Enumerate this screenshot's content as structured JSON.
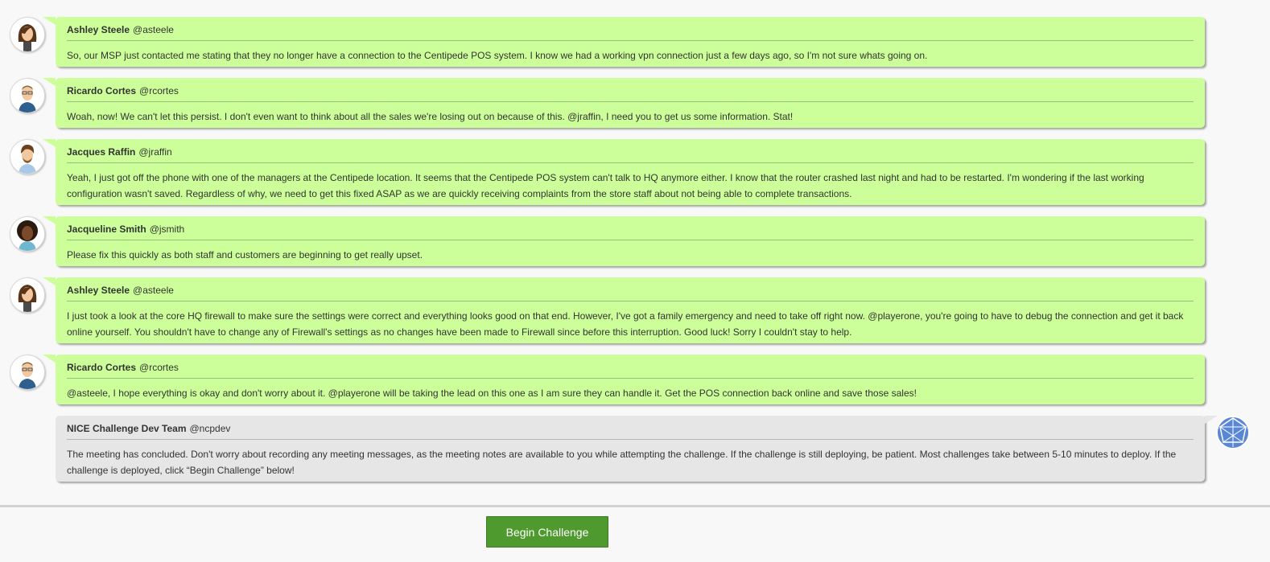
{
  "messages": [
    {
      "name": "Ashley Steele",
      "handle": "@asteele",
      "text": "So, our MSP just contacted me stating that they no longer have a connection to the Centipede POS system. I know we had a working vpn connection just a few days ago, so I'm not sure whats going on."
    },
    {
      "name": "Ricardo Cortes",
      "handle": "@rcortes",
      "text": "Woah, now! We can't let this persist. I don't even want to think about all the sales we're losing out on because of this. @jraffin, I need you to get us some information. Stat!"
    },
    {
      "name": "Jacques Raffin",
      "handle": "@jraffin",
      "text": "Yeah, I just got off the phone with one of the managers at the Centipede location. It seems that the Centipede POS system can't talk to HQ anymore either. I know that the router crashed last night and had to be restarted. I'm wondering if the last working configuration wasn't saved. Regardless of why, we need to get this fixed ASAP as we are quickly receiving complaints from the store staff about not being able to complete transactions."
    },
    {
      "name": "Jacqueline Smith",
      "handle": "@jsmith",
      "text": "Please fix this quickly as both staff and customers are beginning to get really upset."
    },
    {
      "name": "Ashley Steele",
      "handle": "@asteele",
      "text": "I just took a look at the core HQ firewall to make sure the settings were correct and everything looks good on that end. However, I've got a family emergency and need to take off right now. @playerone, you're going to have to debug the connection and get it back online yourself. You shouldn't have to change any of Firewall's settings as no changes have been made to Firewall since before this interruption. Good luck! Sorry I couldn't stay to help."
    },
    {
      "name": "Ricardo Cortes",
      "handle": "@rcortes",
      "text": "@asteele, I hope everything is okay and don't worry about it. @playerone will be taking the lead on this one as I am sure they can handle it. Get the POS connection back online and save those sales!"
    },
    {
      "name": "NICE Challenge Dev Team",
      "handle": "@ncpdev",
      "text": "The meeting has concluded. Don't worry about recording any meeting messages, as the meeting notes are available to you while attempting the challenge. If the challenge is still deploying, be patient. Most challenges take between 5-10 minutes to deploy. If the challenge is deployed, click “Begin Challenge” below!"
    }
  ],
  "avatars": [
    "female-brown-hair-avatar",
    "male-glasses-avatar",
    "male-beard-avatar",
    "female-curly-hair-avatar",
    "female-brown-hair-avatar",
    "male-glasses-avatar",
    "dev-team-logo-icon"
  ],
  "colors": {
    "user_bubble": "#ccff99",
    "system_bubble": "#e6e6e6",
    "button": "#4f9a2f"
  },
  "footer": {
    "button_label": "Begin Challenge"
  }
}
